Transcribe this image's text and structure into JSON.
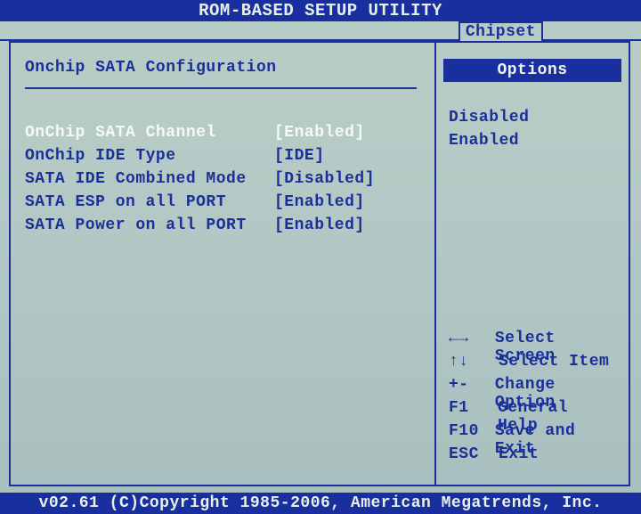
{
  "title": "ROM-BASED SETUP UTILITY",
  "active_tab": "Chipset",
  "section_title": "Onchip SATA Configuration",
  "settings": [
    {
      "label": "OnChip SATA Channel",
      "value": "[Enabled]",
      "selected": true
    },
    {
      "label": "OnChip IDE Type",
      "value": "[IDE]",
      "selected": false
    },
    {
      "label": "SATA IDE Combined Mode",
      "value": "[Disabled]",
      "selected": false
    },
    {
      "label": "SATA ESP on all PORT",
      "value": "[Enabled]",
      "selected": false
    },
    {
      "label": "SATA Power on all PORT",
      "value": "[Enabled]",
      "selected": false
    }
  ],
  "options_panel": {
    "header": "Options",
    "items": [
      "Disabled",
      "Enabled"
    ]
  },
  "hints": [
    {
      "key": "←→",
      "text": "Select Screen"
    },
    {
      "key": "↑↓",
      "text": "Select Item"
    },
    {
      "key": "+-",
      "text": "Change Option"
    },
    {
      "key": "F1",
      "text": "General Help"
    },
    {
      "key": "F10",
      "text": "Save and Exit"
    },
    {
      "key": "ESC",
      "text": "Exit"
    }
  ],
  "footer": "v02.61 (C)Copyright 1985-2006, American Megatrends, Inc."
}
